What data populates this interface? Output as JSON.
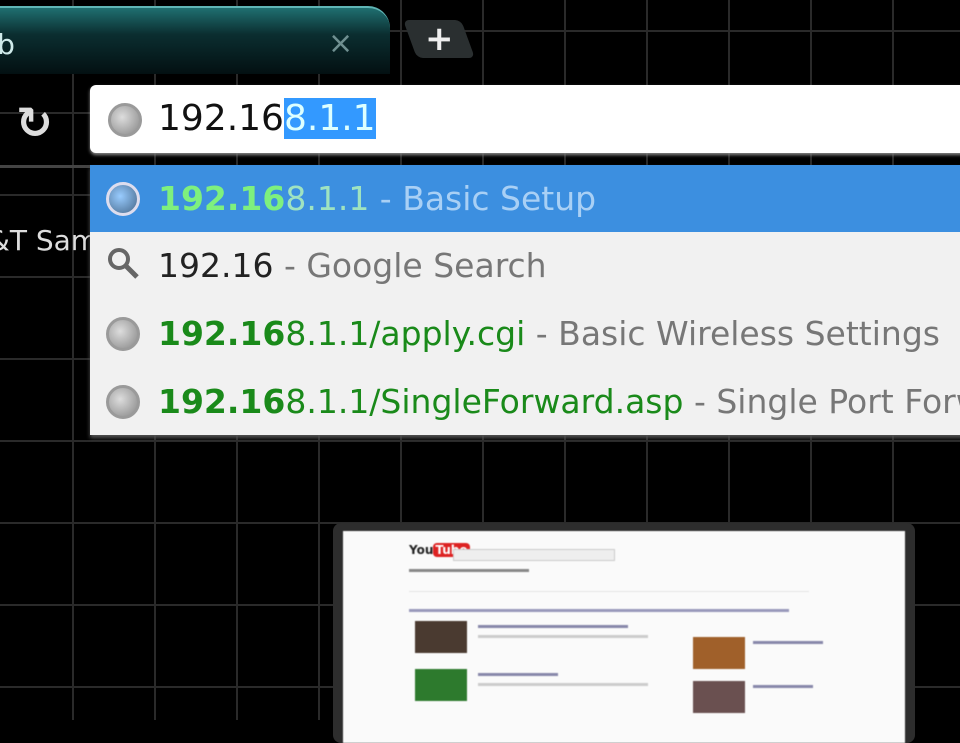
{
  "tab": {
    "title": "ab",
    "close_icon": "×",
    "new_tab_icon": "+"
  },
  "toolbar": {
    "reload_icon": "↻"
  },
  "bookmark": {
    "label": "&T Sam"
  },
  "omnibox": {
    "typed": "192.16",
    "autocomplete": "8.1.1"
  },
  "suggestions": [
    {
      "icon": "globe-icon",
      "match": "192.16",
      "rest": "8.1.1",
      "desc": " - Basic Setup",
      "selected": true
    },
    {
      "icon": "search-icon",
      "match": "192.16",
      "rest": "",
      "desc": " - Google Search",
      "selected": false
    },
    {
      "icon": "globe-icon",
      "match": "192.16",
      "rest": "8.1.1/apply.cgi",
      "desc": " - Basic Wireless Settings",
      "selected": false
    },
    {
      "icon": "globe-icon",
      "match": "192.16",
      "rest": "8.1.1/SingleForward.asp",
      "desc": " - Single Port Forw",
      "selected": false
    }
  ],
  "thumbnail": {
    "logo_a": "You",
    "logo_b": "Tube"
  },
  "colors": {
    "selection": "#3399ff",
    "selected_row": "#3c8fe0",
    "url_green": "#1a8a1a"
  }
}
